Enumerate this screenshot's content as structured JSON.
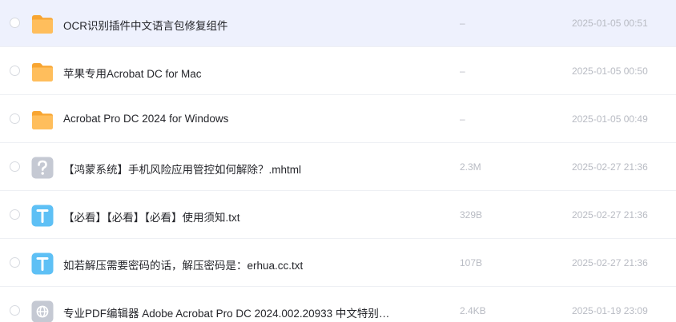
{
  "files": [
    {
      "name": "OCR识别插件中文语言包修复组件",
      "size": "–",
      "date": "2025-01-05 00:51",
      "type": "folder-icon",
      "hover": true
    },
    {
      "name": "苹果专用Acrobat DC for Mac",
      "size": "–",
      "date": "2025-01-05 00:50",
      "type": "folder-icon"
    },
    {
      "name": "Acrobat Pro DC 2024 for Windows",
      "size": "–",
      "date": "2025-01-05 00:49",
      "type": "folder-icon"
    },
    {
      "name": "【鸿蒙系统】手机风险应用管控如何解除？.mhtml",
      "size": "2.3M",
      "date": "2025-02-27 21:36",
      "type": "unknown-file-icon"
    },
    {
      "name": "【必看】【必看】【必看】使用须知.txt",
      "size": "329B",
      "date": "2025-02-27 21:36",
      "type": "text-file-icon"
    },
    {
      "name": "如若解压需要密码的话，解压密码是：erhua.cc.txt",
      "size": "107B",
      "date": "2025-02-27 21:36",
      "type": "text-file-icon"
    },
    {
      "name": "专业PDF编辑器 Adobe Acrobat Pro DC 2024.002.20933 中文特别…",
      "size": "2.4KB",
      "date": "2025-01-19 23:09",
      "type": "web-file-icon"
    }
  ],
  "colors": {
    "hover_row": "#eef1fd",
    "folder": "#ffb84d",
    "text_file": "#5ec0f5",
    "unknown_file": "#c5c9d3",
    "web_file": "#c5c9d3"
  }
}
